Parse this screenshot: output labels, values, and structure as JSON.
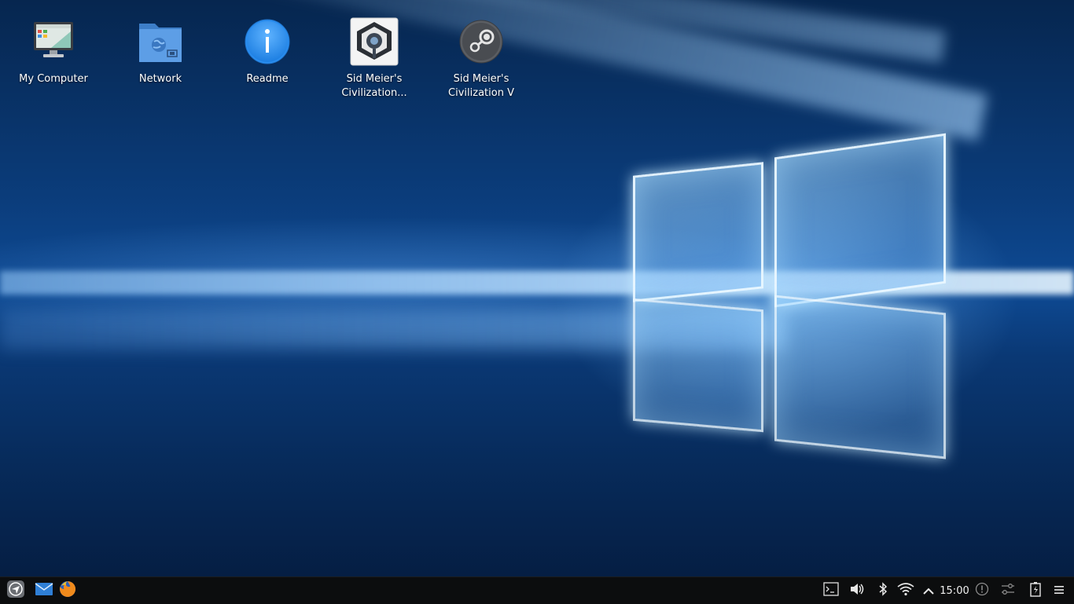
{
  "desktop": {
    "icons": [
      {
        "label": "My Computer",
        "icon": "computer-icon"
      },
      {
        "label": "Network",
        "icon": "network-folder-icon"
      },
      {
        "label": "Readme",
        "icon": "info-icon"
      },
      {
        "label": "Sid Meier's Civilization...",
        "icon": "civilization-game-icon"
      },
      {
        "label": "Sid Meier's Civilization V",
        "icon": "steam-icon"
      }
    ]
  },
  "taskbar": {
    "launcher": {
      "icon": "app-launcher-icon"
    },
    "pinned": [
      {
        "icon": "mail-icon"
      },
      {
        "icon": "firefox-icon"
      }
    ],
    "tray": {
      "clock": "15:00",
      "icons": [
        "terminal-icon",
        "volume-icon",
        "bluetooth-icon",
        "wifi-icon",
        "chevron-up-icon",
        "notification-icon",
        "settings-sliders-icon",
        "battery-icon",
        "menu-icon"
      ]
    }
  },
  "colors": {
    "taskbar_bg": "#0c0d0e",
    "wallpaper_blue": "#0e4a94",
    "readme_blue": "#2a8ef0"
  }
}
